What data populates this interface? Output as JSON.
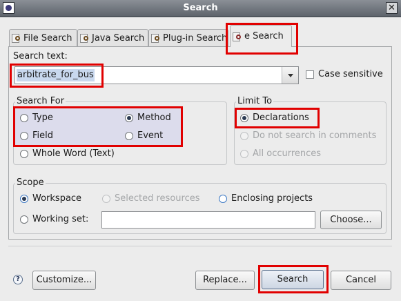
{
  "window": {
    "title": "Search"
  },
  "tabs": [
    {
      "label": "File Search",
      "icon": "file-search-icon"
    },
    {
      "label": "Java Search",
      "icon": "java-search-icon"
    },
    {
      "label": "Plug-in Search",
      "icon": "plugin-search-icon"
    },
    {
      "label": "e Search",
      "icon": "e-search-icon",
      "active": true
    }
  ],
  "search": {
    "label": "Search text:",
    "value": "arbitrate_for_bus",
    "case_sensitive_label": "Case sensitive",
    "case_sensitive": false
  },
  "search_for": {
    "title": "Search For",
    "options": [
      {
        "label": "Type",
        "checked": false
      },
      {
        "label": "Method",
        "checked": true
      },
      {
        "label": "Field",
        "checked": false
      },
      {
        "label": "Event",
        "checked": false
      },
      {
        "label": "Whole Word (Text)",
        "checked": false
      }
    ]
  },
  "limit_to": {
    "title": "Limit To",
    "options": [
      {
        "label": "Declarations",
        "checked": true,
        "enabled": true
      },
      {
        "label": "Do not search in comments",
        "checked": false,
        "enabled": false
      },
      {
        "label": "All occurrences",
        "checked": false,
        "enabled": false
      }
    ]
  },
  "scope": {
    "title": "Scope",
    "options": [
      {
        "label": "Workspace",
        "checked": true,
        "enabled": true
      },
      {
        "label": "Selected resources",
        "checked": false,
        "enabled": false
      },
      {
        "label": "Enclosing projects",
        "checked": false,
        "enabled": true
      },
      {
        "label": "Working set:",
        "checked": false,
        "enabled": true
      }
    ],
    "working_set_value": "",
    "choose_label": "Choose..."
  },
  "buttons": {
    "customize": "Customize...",
    "replace": "Replace...",
    "search": "Search",
    "cancel": "Cancel"
  },
  "colors": {
    "highlight": "#e10000",
    "title_bar": "#5d636b"
  }
}
